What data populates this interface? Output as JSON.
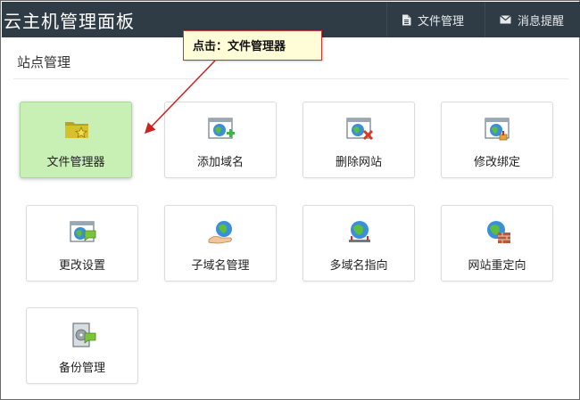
{
  "header": {
    "title": "云主机管理面板",
    "nav": [
      {
        "label": "文件管理",
        "icon": "file-icon"
      },
      {
        "label": "消息提醒",
        "icon": "envelope-icon"
      }
    ],
    "bg_color": "#2f3b45"
  },
  "section": {
    "title": "站点管理"
  },
  "tiles": [
    {
      "label": "文件管理器",
      "icon": "folder-star-icon",
      "active": true
    },
    {
      "label": "添加域名",
      "icon": "window-globe-add-icon",
      "active": false
    },
    {
      "label": "删除网站",
      "icon": "window-globe-delete-icon",
      "active": false
    },
    {
      "label": "修改绑定",
      "icon": "window-globe-pin-icon",
      "active": false
    },
    {
      "label": "更改设置",
      "icon": "window-settings-icon",
      "active": false
    },
    {
      "label": "子域名管理",
      "icon": "globe-hand-icon",
      "active": false
    },
    {
      "label": "多域名指向",
      "icon": "globe-pins-icon",
      "active": false
    },
    {
      "label": "网站重定向",
      "icon": "globe-wall-icon",
      "active": false
    },
    {
      "label": "备份管理",
      "icon": "backup-disk-icon",
      "active": false
    }
  ],
  "callout": {
    "text": "点击：文件管理器",
    "border_color": "#c03a3a"
  },
  "colors": {
    "active_tile": "#c8f0b4",
    "arrow": "#cc2222"
  }
}
